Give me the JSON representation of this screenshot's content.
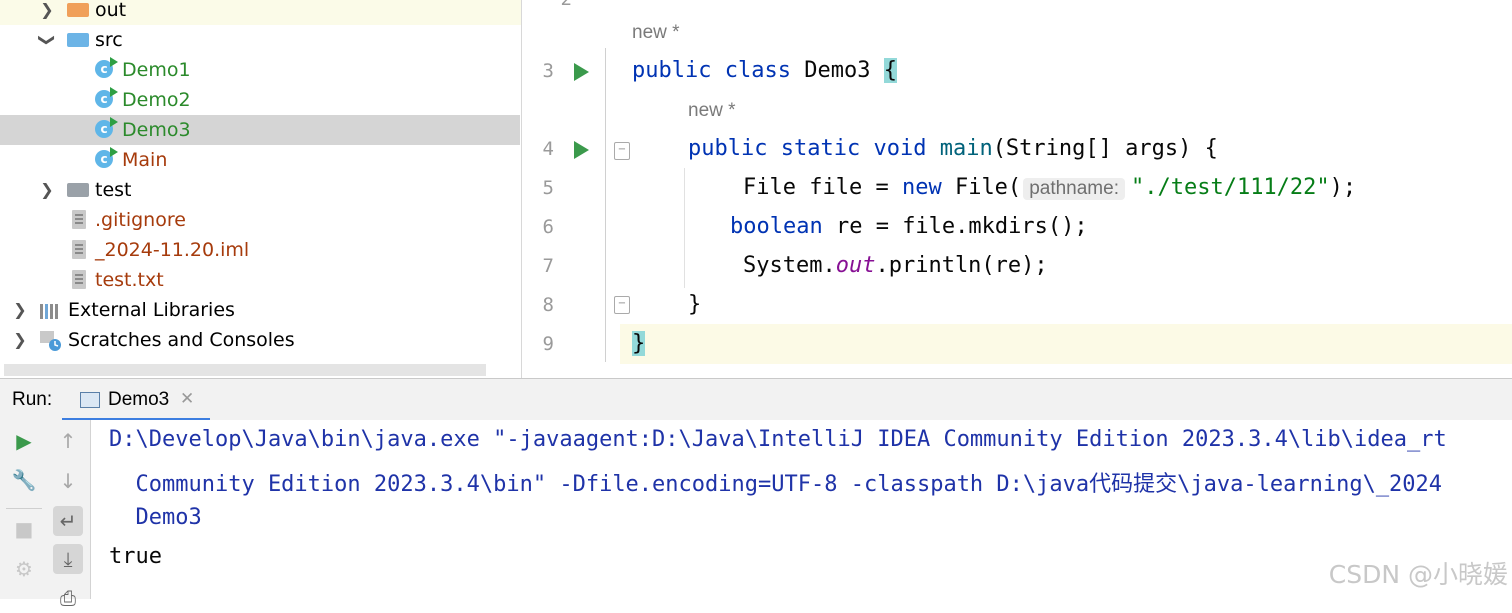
{
  "project_tree": {
    "items": [
      {
        "label": "out",
        "type": "folder-orange",
        "expanded": false,
        "color": "#000000"
      },
      {
        "label": "src",
        "type": "folder-blue",
        "expanded": true,
        "color": "#000000"
      },
      {
        "label": "Demo1",
        "type": "class",
        "color": "#2b8a2b"
      },
      {
        "label": "Demo2",
        "type": "class",
        "color": "#2b8a2b"
      },
      {
        "label": "Demo3",
        "type": "class",
        "color": "#2b8a2b",
        "selected": true
      },
      {
        "label": "Main",
        "type": "class",
        "color": "#a63b0c"
      },
      {
        "label": "test",
        "type": "folder-gray",
        "expanded": false,
        "color": "#000000"
      },
      {
        "label": ".gitignore",
        "type": "file",
        "color": "#a63b0c"
      },
      {
        "label": "_2024-11.20.iml",
        "type": "file",
        "color": "#a63b0c"
      },
      {
        "label": "test.txt",
        "type": "file",
        "color": "#a63b0c"
      },
      {
        "label": "External Libraries",
        "type": "libraries",
        "expanded": false,
        "color": "#000000"
      },
      {
        "label": "Scratches and Consoles",
        "type": "scratches",
        "expanded": false,
        "color": "#000000"
      }
    ]
  },
  "editor": {
    "hint_class": "new *",
    "hint_method": "new *",
    "line_numbers": [
      "3",
      "4",
      "5",
      "6",
      "7",
      "8",
      "9"
    ],
    "line3": {
      "kw1": "public",
      "kw2": "class",
      "name": "Demo3",
      "brace": "{"
    },
    "line4": {
      "kw1": "public",
      "kw2": "static",
      "kw3": "void",
      "name": "main",
      "rest": "(String[] args) {"
    },
    "line5": {
      "pre": "File file = ",
      "kw": "new",
      "mid": " File(",
      "param_hint": "pathname:",
      "str": "\"./test/111/22\"",
      "end": ");"
    },
    "line6": {
      "kw": "boolean",
      "rest": " re = file.mkdirs();"
    },
    "line7": {
      "pre": "System.",
      "field": "out",
      "rest": ".println(re);"
    },
    "line8": {
      "text": "}"
    },
    "line9": {
      "text": "}"
    }
  },
  "run_panel": {
    "label": "Run:",
    "tab_label": "Demo3",
    "console": {
      "line1": "D:\\Develop\\Java\\bin\\java.exe \"-javaagent:D:\\Java\\IntelliJ IDEA Community Edition 2023.3.4\\lib\\idea_rt",
      "line2": "  Community Edition 2023.3.4\\bin\" -Dfile.encoding=UTF-8 -classpath D:\\java代码提交\\java-learning\\_2024",
      "line3": "  Demo3",
      "line4": "true"
    }
  },
  "watermark": "CSDN @小晓媛"
}
